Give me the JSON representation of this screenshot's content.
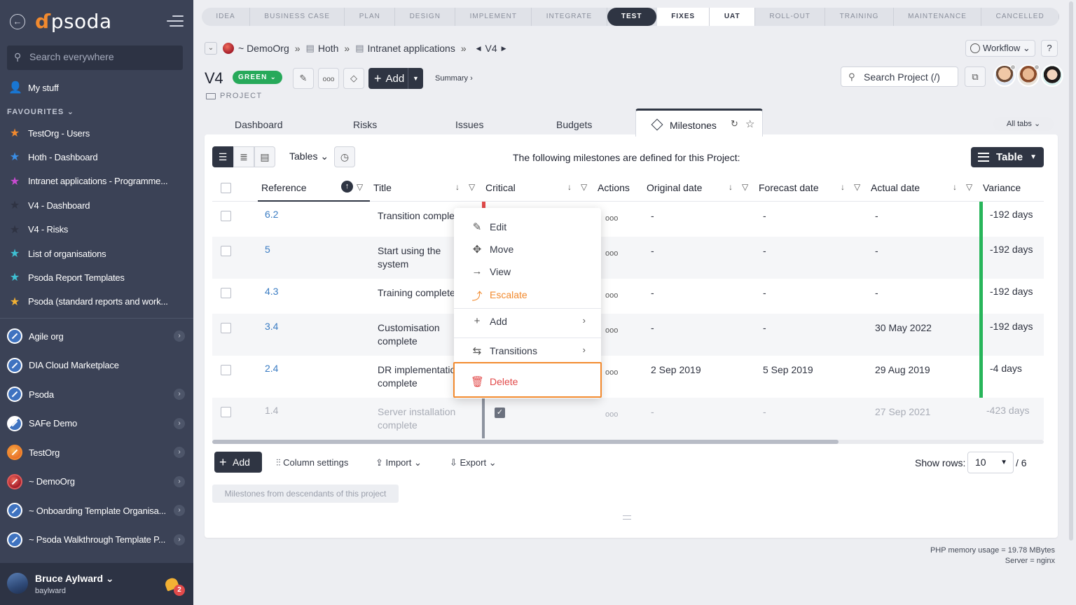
{
  "sidebar": {
    "search_placeholder": "Search everywhere",
    "my_stuff": "My stuff",
    "favourites_label": "FAVOURITES",
    "favourites": [
      {
        "label": "TestOrg - Users",
        "color": "#f28a2e"
      },
      {
        "label": "Hoth - Dashboard",
        "color": "#3a8ee6"
      },
      {
        "label": "Intranet applications - Programme...",
        "color": "#c94bd1"
      },
      {
        "label": "V4 - Dashboard",
        "color": "#2f3343"
      },
      {
        "label": "V4 - Risks",
        "color": "#2f3343"
      },
      {
        "label": "List of organisations",
        "color": "#3ec1d3"
      },
      {
        "label": "Psoda Report Templates",
        "color": "#3ec1d3"
      },
      {
        "label": "Psoda (standard reports and work...",
        "color": "#f2b134"
      }
    ],
    "orgs": [
      {
        "label": "Agile org",
        "chevron": true
      },
      {
        "label": "DIA Cloud Marketplace",
        "chevron": false
      },
      {
        "label": "Psoda",
        "chevron": true
      },
      {
        "label": "SAFe Demo",
        "chevron": true
      },
      {
        "label": "TestOrg",
        "chevron": true
      },
      {
        "label": "~ DemoOrg",
        "chevron": true
      },
      {
        "label": "~ Onboarding Template Organisa...",
        "chevron": true
      },
      {
        "label": "~ Psoda Walkthrough Template P...",
        "chevron": true
      }
    ],
    "user": {
      "name": "Bruce Aylward",
      "login": "baylward",
      "notifications": "2"
    }
  },
  "phases": [
    "IDEA",
    "BUSINESS CASE",
    "PLAN",
    "DESIGN",
    "IMPLEMENT",
    "INTEGRATE",
    "TEST",
    "FIXES",
    "UAT",
    "ROLL-OUT",
    "TRAINING",
    "MAINTENANCE",
    "CANCELLED"
  ],
  "active_phase": "TEST",
  "breadcrumb": {
    "org": "~ DemoOrg",
    "programme": "Hoth",
    "sub": "Intranet applications",
    "project": "V4"
  },
  "header": {
    "title": "V4",
    "status": "GREEN",
    "type_label": "PROJECT",
    "add_label": "Add",
    "summary_label": "Summary ›",
    "workflow_label": "Workflow",
    "help_label": "?",
    "search_placeholder": "Search Project (/)"
  },
  "tabs": [
    {
      "label": "Dashboard"
    },
    {
      "label": "Risks"
    },
    {
      "label": "Issues"
    },
    {
      "label": "Budgets"
    }
  ],
  "active_tab": "Milestones",
  "all_tabs_label": "All tabs",
  "toolbar": {
    "tables_label": "Tables",
    "info_text": "The following milestones are defined for this Project:",
    "view_label": "Table"
  },
  "columns": [
    "Reference",
    "Title",
    "Critical",
    "Actions",
    "Original date",
    "Forecast date",
    "Actual date",
    "Variance"
  ],
  "rows": [
    {
      "ref": "6.2",
      "title": [
        "Transition comple"
      ],
      "original": "-",
      "forecast": "-",
      "actual": "-",
      "variance": "-192 days"
    },
    {
      "ref": "5",
      "title": [
        "Start using the",
        "system"
      ],
      "original": "-",
      "forecast": "-",
      "actual": "-",
      "variance": "-192 days"
    },
    {
      "ref": "4.3",
      "title": [
        "Training complete"
      ],
      "original": "-",
      "forecast": "-",
      "actual": "-",
      "variance": "-192 days"
    },
    {
      "ref": "3.4",
      "title": [
        "Customisation",
        "complete"
      ],
      "original": "-",
      "forecast": "-",
      "actual": "30 May 2022",
      "variance": "-192 days"
    },
    {
      "ref": "2.4",
      "title": [
        "DR implementatio",
        "complete"
      ],
      "original": "2 Sep 2019",
      "forecast": "5 Sep 2019",
      "actual": "29 Aug 2019",
      "variance": "-4 days"
    },
    {
      "ref": "1.4",
      "title": [
        "Server installation",
        "complete"
      ],
      "original": "-",
      "forecast": "-",
      "actual": "27 Sep 2021",
      "variance": "-423 days"
    }
  ],
  "context_menu": {
    "edit": "Edit",
    "move": "Move",
    "view": "View",
    "escalate": "Escalate",
    "add": "Add",
    "transitions": "Transitions",
    "delete": "Delete"
  },
  "footer": {
    "add_label": "Add",
    "column_settings": "Column settings",
    "import": "Import",
    "export": "Export",
    "show_rows_label": "Show rows:",
    "rows_value": "10",
    "total": "/ 6",
    "descendants_button": "Milestones from descendants of this project"
  },
  "memory": {
    "line1": "PHP memory usage = 19.78 MBytes",
    "line2": "Server = nginx"
  }
}
